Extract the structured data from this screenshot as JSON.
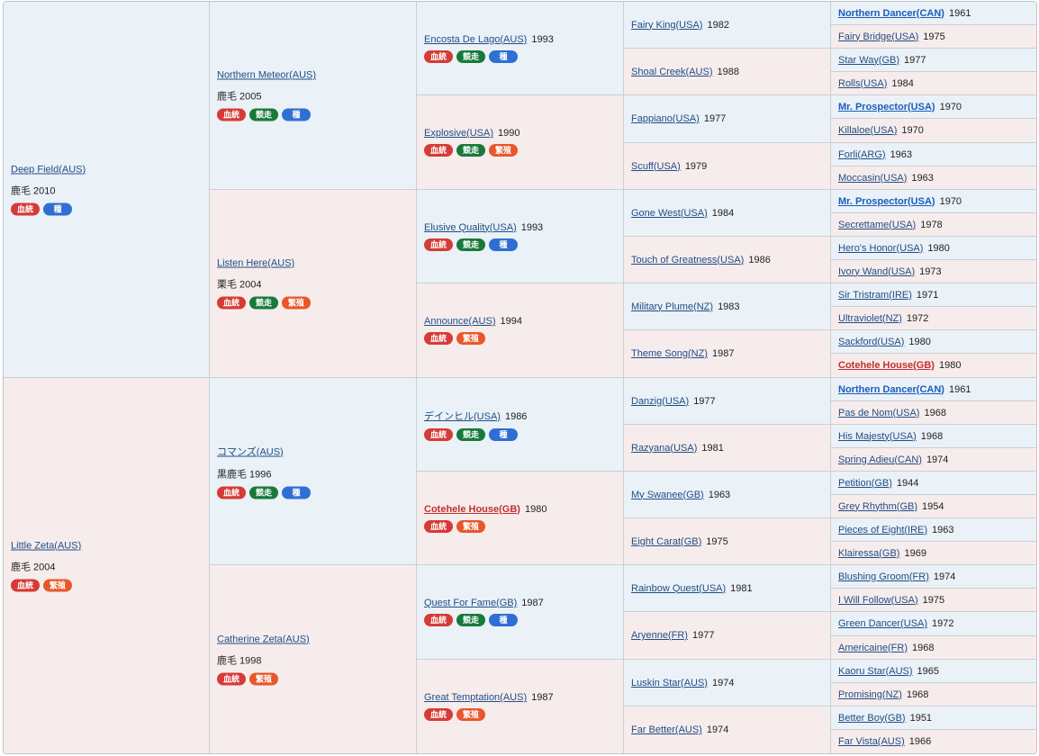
{
  "pedigree": {
    "gen1": [
      {
        "name": "Deep Field(AUS)",
        "sex": "m",
        "sub": "鹿毛 2010",
        "tags": [
          "blood",
          "sire"
        ]
      },
      {
        "name": "Little Zeta(AUS)",
        "sex": "f",
        "sub": "鹿毛 2004",
        "tags": [
          "blood",
          "breed"
        ]
      }
    ],
    "gen2": [
      {
        "name": "Northern Meteor(AUS)",
        "sex": "m",
        "sub": "鹿毛 2005",
        "tags": [
          "blood",
          "race",
          "sire"
        ]
      },
      {
        "name": "Listen Here(AUS)",
        "sex": "f",
        "sub": "栗毛 2004",
        "tags": [
          "blood",
          "race",
          "breed"
        ]
      },
      {
        "name": "コマンズ(AUS)",
        "sex": "m",
        "sub": "黒鹿毛 1996",
        "tags": [
          "blood",
          "race",
          "sire"
        ]
      },
      {
        "name": "Catherine Zeta(AUS)",
        "sex": "f",
        "sub": "鹿毛 1998",
        "tags": [
          "blood",
          "breed"
        ]
      }
    ],
    "gen3": [
      {
        "name": "Encosta De Lago(AUS)",
        "year": "1993",
        "sex": "m",
        "tags": [
          "blood",
          "race",
          "sire"
        ]
      },
      {
        "name": "Explosive(USA)",
        "year": "1990",
        "sex": "f",
        "tags": [
          "blood",
          "race",
          "breed"
        ]
      },
      {
        "name": "Elusive Quality(USA)",
        "year": "1993",
        "sex": "m",
        "tags": [
          "blood",
          "race",
          "sire"
        ]
      },
      {
        "name": "Announce(AUS)",
        "year": "1994",
        "sex": "f",
        "tags": [
          "blood",
          "breed"
        ]
      },
      {
        "name": "デインヒル(USA)",
        "year": "1986",
        "sex": "m",
        "tags": [
          "blood",
          "race",
          "sire"
        ]
      },
      {
        "name": "Cotehele House(GB)",
        "year": "1980",
        "sex": "f",
        "style": "red",
        "tags": [
          "blood",
          "breed"
        ]
      },
      {
        "name": "Quest For Fame(GB)",
        "year": "1987",
        "sex": "m",
        "tags": [
          "blood",
          "race",
          "sire"
        ]
      },
      {
        "name": "Great Temptation(AUS)",
        "year": "1987",
        "sex": "f",
        "tags": [
          "blood",
          "breed"
        ]
      }
    ],
    "gen4": [
      {
        "name": "Fairy King(USA)",
        "year": "1982",
        "sex": "m"
      },
      {
        "name": "Shoal Creek(AUS)",
        "year": "1988",
        "sex": "f"
      },
      {
        "name": "Fappiano(USA)",
        "year": "1977",
        "sex": "m"
      },
      {
        "name": "Scuff(USA)",
        "year": "1979",
        "sex": "f"
      },
      {
        "name": "Gone West(USA)",
        "year": "1984",
        "sex": "m"
      },
      {
        "name": "Touch of Greatness(USA)",
        "year": "1986",
        "sex": "f"
      },
      {
        "name": "Military Plume(NZ)",
        "year": "1983",
        "sex": "m"
      },
      {
        "name": "Theme Song(NZ)",
        "year": "1987",
        "sex": "f"
      },
      {
        "name": "Danzig(USA)",
        "year": "1977",
        "sex": "m"
      },
      {
        "name": "Razyana(USA)",
        "year": "1981",
        "sex": "f"
      },
      {
        "name": "My Swanee(GB)",
        "year": "1963",
        "sex": "m"
      },
      {
        "name": "Eight Carat(GB)",
        "year": "1975",
        "sex": "f"
      },
      {
        "name": "Rainbow Quest(USA)",
        "year": "1981",
        "sex": "m"
      },
      {
        "name": "Aryenne(FR)",
        "year": "1977",
        "sex": "f"
      },
      {
        "name": "Luskin Star(AUS)",
        "year": "1974",
        "sex": "m"
      },
      {
        "name": "Far Better(AUS)",
        "year": "1974",
        "sex": "f"
      }
    ],
    "gen5": [
      {
        "name": "Northern Dancer(CAN)",
        "year": "1961",
        "sex": "m",
        "style": "bold"
      },
      {
        "name": "Fairy Bridge(USA)",
        "year": "1975",
        "sex": "f"
      },
      {
        "name": "Star Way(GB)",
        "year": "1977",
        "sex": "m"
      },
      {
        "name": "Rolls(USA)",
        "year": "1984",
        "sex": "f"
      },
      {
        "name": "Mr. Prospector(USA)",
        "year": "1970",
        "sex": "m",
        "style": "bold"
      },
      {
        "name": "Killaloe(USA)",
        "year": "1970",
        "sex": "f"
      },
      {
        "name": "Forli(ARG)",
        "year": "1963",
        "sex": "m"
      },
      {
        "name": "Moccasin(USA)",
        "year": "1963",
        "sex": "f"
      },
      {
        "name": "Mr. Prospector(USA)",
        "year": "1970",
        "sex": "m",
        "style": "bold"
      },
      {
        "name": "Secrettame(USA)",
        "year": "1978",
        "sex": "f"
      },
      {
        "name": "Hero's Honor(USA)",
        "year": "1980",
        "sex": "m"
      },
      {
        "name": "Ivory Wand(USA)",
        "year": "1973",
        "sex": "f"
      },
      {
        "name": "Sir Tristram(IRE)",
        "year": "1971",
        "sex": "m"
      },
      {
        "name": "Ultraviolet(NZ)",
        "year": "1972",
        "sex": "f"
      },
      {
        "name": "Sackford(USA)",
        "year": "1980",
        "sex": "m"
      },
      {
        "name": "Cotehele House(GB)",
        "year": "1980",
        "sex": "f",
        "style": "red"
      },
      {
        "name": "Northern Dancer(CAN)",
        "year": "1961",
        "sex": "m",
        "style": "bold"
      },
      {
        "name": "Pas de Nom(USA)",
        "year": "1968",
        "sex": "f"
      },
      {
        "name": "His Majesty(USA)",
        "year": "1968",
        "sex": "m"
      },
      {
        "name": "Spring Adieu(CAN)",
        "year": "1974",
        "sex": "f"
      },
      {
        "name": "Petition(GB)",
        "year": "1944",
        "sex": "m"
      },
      {
        "name": "Grey Rhythm(GB)",
        "year": "1954",
        "sex": "f"
      },
      {
        "name": "Pieces of Eight(IRE)",
        "year": "1963",
        "sex": "m"
      },
      {
        "name": "Klairessa(GB)",
        "year": "1969",
        "sex": "f"
      },
      {
        "name": "Blushing Groom(FR)",
        "year": "1974",
        "sex": "m"
      },
      {
        "name": "I Will Follow(USA)",
        "year": "1975",
        "sex": "f"
      },
      {
        "name": "Green Dancer(USA)",
        "year": "1972",
        "sex": "m"
      },
      {
        "name": "Americaine(FR)",
        "year": "1968",
        "sex": "f"
      },
      {
        "name": "Kaoru Star(AUS)",
        "year": "1965",
        "sex": "m"
      },
      {
        "name": "Promising(NZ)",
        "year": "1968",
        "sex": "f"
      },
      {
        "name": "Better Boy(GB)",
        "year": "1951",
        "sex": "m"
      },
      {
        "name": "Far Vista(AUS)",
        "year": "1966",
        "sex": "f"
      }
    ]
  },
  "tag_labels": {
    "blood": "血統",
    "race": "競走",
    "sire": "種",
    "breed": "繁殖"
  },
  "tag_colors": {
    "blood": "#d63b37",
    "race": "#187a3a",
    "sire": "#2f6fd3",
    "breed": "#e8572a"
  },
  "colors": {
    "male_bg": "#eaf1f7",
    "female_bg": "#f7ecec",
    "link": "#1f4e85",
    "bold_link": "#1a5ebd",
    "red_link": "#c2312e"
  }
}
